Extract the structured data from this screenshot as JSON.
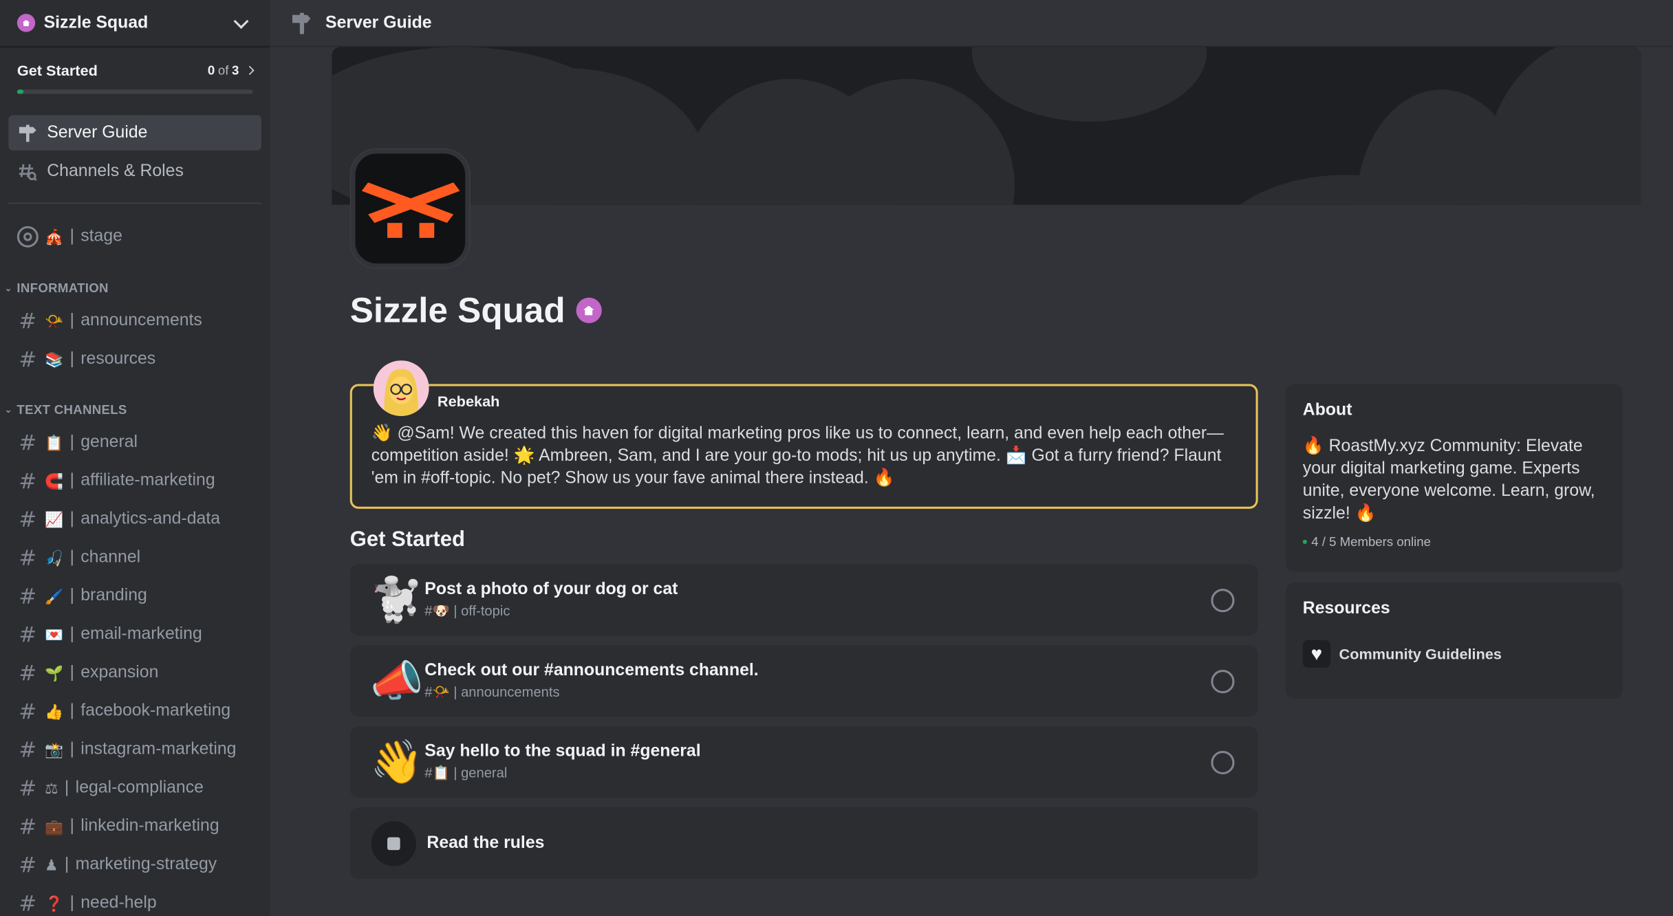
{
  "server": {
    "name": "Sizzle Squad"
  },
  "get_started": {
    "title": "Get Started",
    "done": "0",
    "of": "of",
    "total": "3"
  },
  "nav": [
    {
      "label": "Server Guide",
      "icon": "signpost-icon",
      "active": true
    },
    {
      "label": "Channels & Roles",
      "icon": "channel-browse-icon",
      "active": false
    }
  ],
  "stage": {
    "emoji": "🎪",
    "name": "stage"
  },
  "categories": {
    "information": "INFORMATION",
    "text_channels": "TEXT CHANNELS"
  },
  "information_channels": [
    {
      "emoji": "📯",
      "name": "announcements"
    },
    {
      "emoji": "📚",
      "name": "resources"
    }
  ],
  "text_channels": [
    {
      "emoji": "📋",
      "name": "general"
    },
    {
      "emoji": "🧲",
      "name": "affiliate-marketing"
    },
    {
      "emoji": "📈",
      "name": "analytics-and-data"
    },
    {
      "emoji": "🎣",
      "name": "channel"
    },
    {
      "emoji": "🖌️",
      "name": "branding"
    },
    {
      "emoji": "💌",
      "name": "email-marketing"
    },
    {
      "emoji": "🌱",
      "name": "expansion"
    },
    {
      "emoji": "👍",
      "name": "facebook-marketing"
    },
    {
      "emoji": "📸",
      "name": "instagram-marketing"
    },
    {
      "emoji": "⚖",
      "name": "legal-compliance"
    },
    {
      "emoji": "💼",
      "name": "linkedin-marketing"
    },
    {
      "emoji": "♟",
      "name": "marketing-strategy"
    },
    {
      "emoji": "❓",
      "name": "need-help"
    }
  ],
  "separator": "|",
  "topbar": {
    "title": "Server Guide"
  },
  "welcome": {
    "author": "Rebekah",
    "message": "👋 @Sam! We created this haven for digital marketing pros like us to connect, learn, and even help each other—competition aside! 🌟 Ambreen, Sam, and I are your go-to mods; hit us up anytime. 📩 Got a furry friend? Flaunt 'em in #off-topic. No pet? Show us your fave animal there instead. 🔥"
  },
  "tasks_heading": "Get Started",
  "tasks": [
    {
      "emoji": "🐩",
      "title": "Post a photo of your dog or cat",
      "sub": "#🐶 | off-topic"
    },
    {
      "emoji": "📣",
      "title": "Check out our #announcements channel.",
      "sub": "#📯 | announcements"
    },
    {
      "emoji": "👋",
      "title": "Say hello to the squad in #general",
      "sub": "#📋 | general"
    }
  ],
  "rules_task": {
    "title": "Read the rules"
  },
  "about": {
    "title": "About",
    "text": "🔥 RoastMy.xyz Community: Elevate your digital marketing game. Experts unite, everyone welcome. Learn, grow, sizzle! 🔥",
    "members": "4 / 5 Members online"
  },
  "resources": {
    "title": "Resources",
    "items": [
      {
        "label": "Community Guidelines",
        "icon": "heart-icon"
      }
    ]
  },
  "colors": {
    "accent": "#e6c25a",
    "online": "#23a55a",
    "brand_orange": "#ff5a1f",
    "server_badge": "#c266c8"
  }
}
